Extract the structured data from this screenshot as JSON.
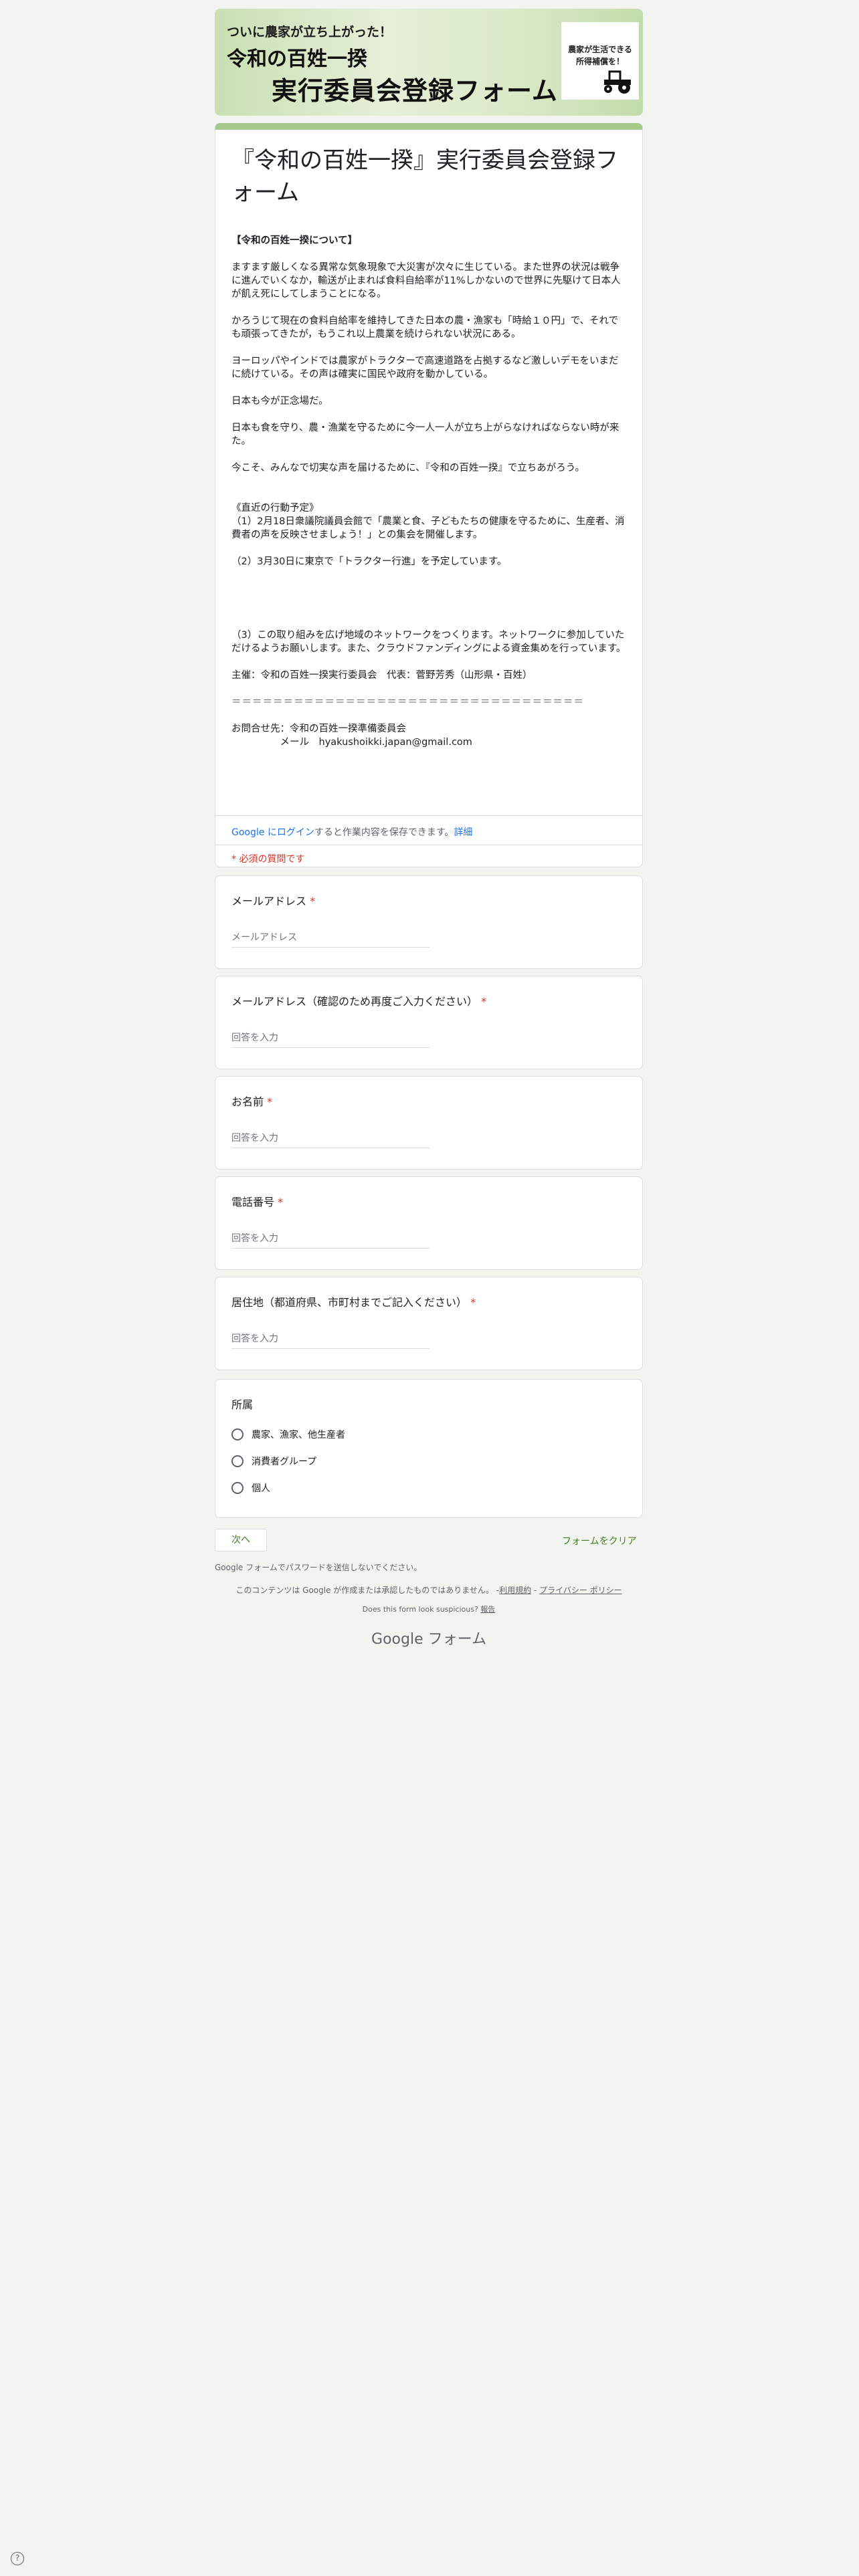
{
  "header": {
    "banner_line1": "ついに農家が立ち上がった！",
    "banner_line2": "令和の百姓一揆",
    "banner_line3": "実行委員会登録フォーム",
    "badge_text": "農家が生活できる所得補償を！",
    "badge_icon": "tractor-icon"
  },
  "description": {
    "title": "『令和の百姓一揆』実行委員会登録フォーム",
    "heading": "【令和の百姓一揆について】",
    "para1": "ますます厳しくなる異常な気象現象で大災害が次々に生じている。また世界の状況は戦争に進んでいくなか，輸送が止まれば食料自給率が11%しかないので世界に先駆けて日本人が飢え死にしてしまうことになる。",
    "para2": "かろうじて現在の食料自給率を維持してきた日本の農・漁家も「時給１０円」で、それでも頑張ってきたが，もうこれ以上農業を続けられない状況にある。",
    "para3": "ヨーロッパやインドでは農家がトラクターで高速道路を占拠するなど激しいデモをいまだに続けている。その声は確実に国民や政府を動かしている。",
    "para4": "日本も今が正念場だ。",
    "para5": "日本も食を守り、農・漁業を守るために今一人一人が立ち上がらなければならない時が来た。",
    "para6": "今こそ、みんなで切実な声を届けるために、『令和の百姓一揆』で立ちあがろう。",
    "schedule_heading": "《直近の行動予定》",
    "schedule1": "（1）2月18日衆議院議員会館で「農業と食、子どもたちの健康を守るために、生産者、消費者の声を反映させましょう！」との集会を開催します。",
    "schedule2": "（2）3月30日に東京で「トラクター行進」を予定しています。",
    "schedule3": "（3）この取り組みを広げ地域のネットワークをつくります。ネットワークに参加していただけるようお願いします。また、クラウドファンディングによる資金集めを行っています。",
    "organizer": "主催：令和の百姓一揆実行委員会　代表：菅野芳秀（山形県・百姓）",
    "separator": "＝＝＝＝＝＝＝＝＝＝＝＝＝＝＝＝＝＝＝＝＝＝＝＝＝＝＝＝＝＝＝＝＝＝",
    "contact": "お問合せ先：令和の百姓一揆準備委員会",
    "contact_mail": "　　　　　メール　hyakushoikki.japan@gmail.com"
  },
  "signin": {
    "link": "Google にログイン",
    "text": "すると作業内容を保存できます。",
    "details": "詳細"
  },
  "required_note": "* 必須の質問です",
  "questions": [
    {
      "label": "メールアドレス",
      "required": "*",
      "placeholder": "メールアドレス"
    },
    {
      "label": "メールアドレス（確認のため再度ご入力ください）",
      "required": "*",
      "placeholder": "回答を入力"
    },
    {
      "label": "お名前",
      "required": "*",
      "placeholder": "回答を入力"
    },
    {
      "label": "電話番号",
      "required": "*",
      "placeholder": "回答を入力"
    },
    {
      "label": "居住地（都道府県、市町村までご記入ください）",
      "required": "*",
      "placeholder": "回答を入力"
    }
  ],
  "affiliation": {
    "label": "所属",
    "options": [
      "農家、漁家、他生産者",
      "消費者グループ",
      "個人"
    ]
  },
  "footer": {
    "next": "次へ",
    "clear": "フォームをクリア",
    "password_note": "Google フォームでパスワードを送信しないでください。",
    "disclaimer": "このコンテンツは Google が作成または承認したものではありません。 -",
    "terms": "利用規約",
    "privacy": "プライバシー ポリシー",
    "suspicious": "Does this form look suspicious?",
    "report": "報告",
    "logo": "Google フォーム",
    "help": "?"
  },
  "colors": {
    "background": "#f2f5ef",
    "accent": "#a5c98a",
    "button_text": "#4a7a2a",
    "required": "#d93025",
    "link": "#1a73e8"
  }
}
